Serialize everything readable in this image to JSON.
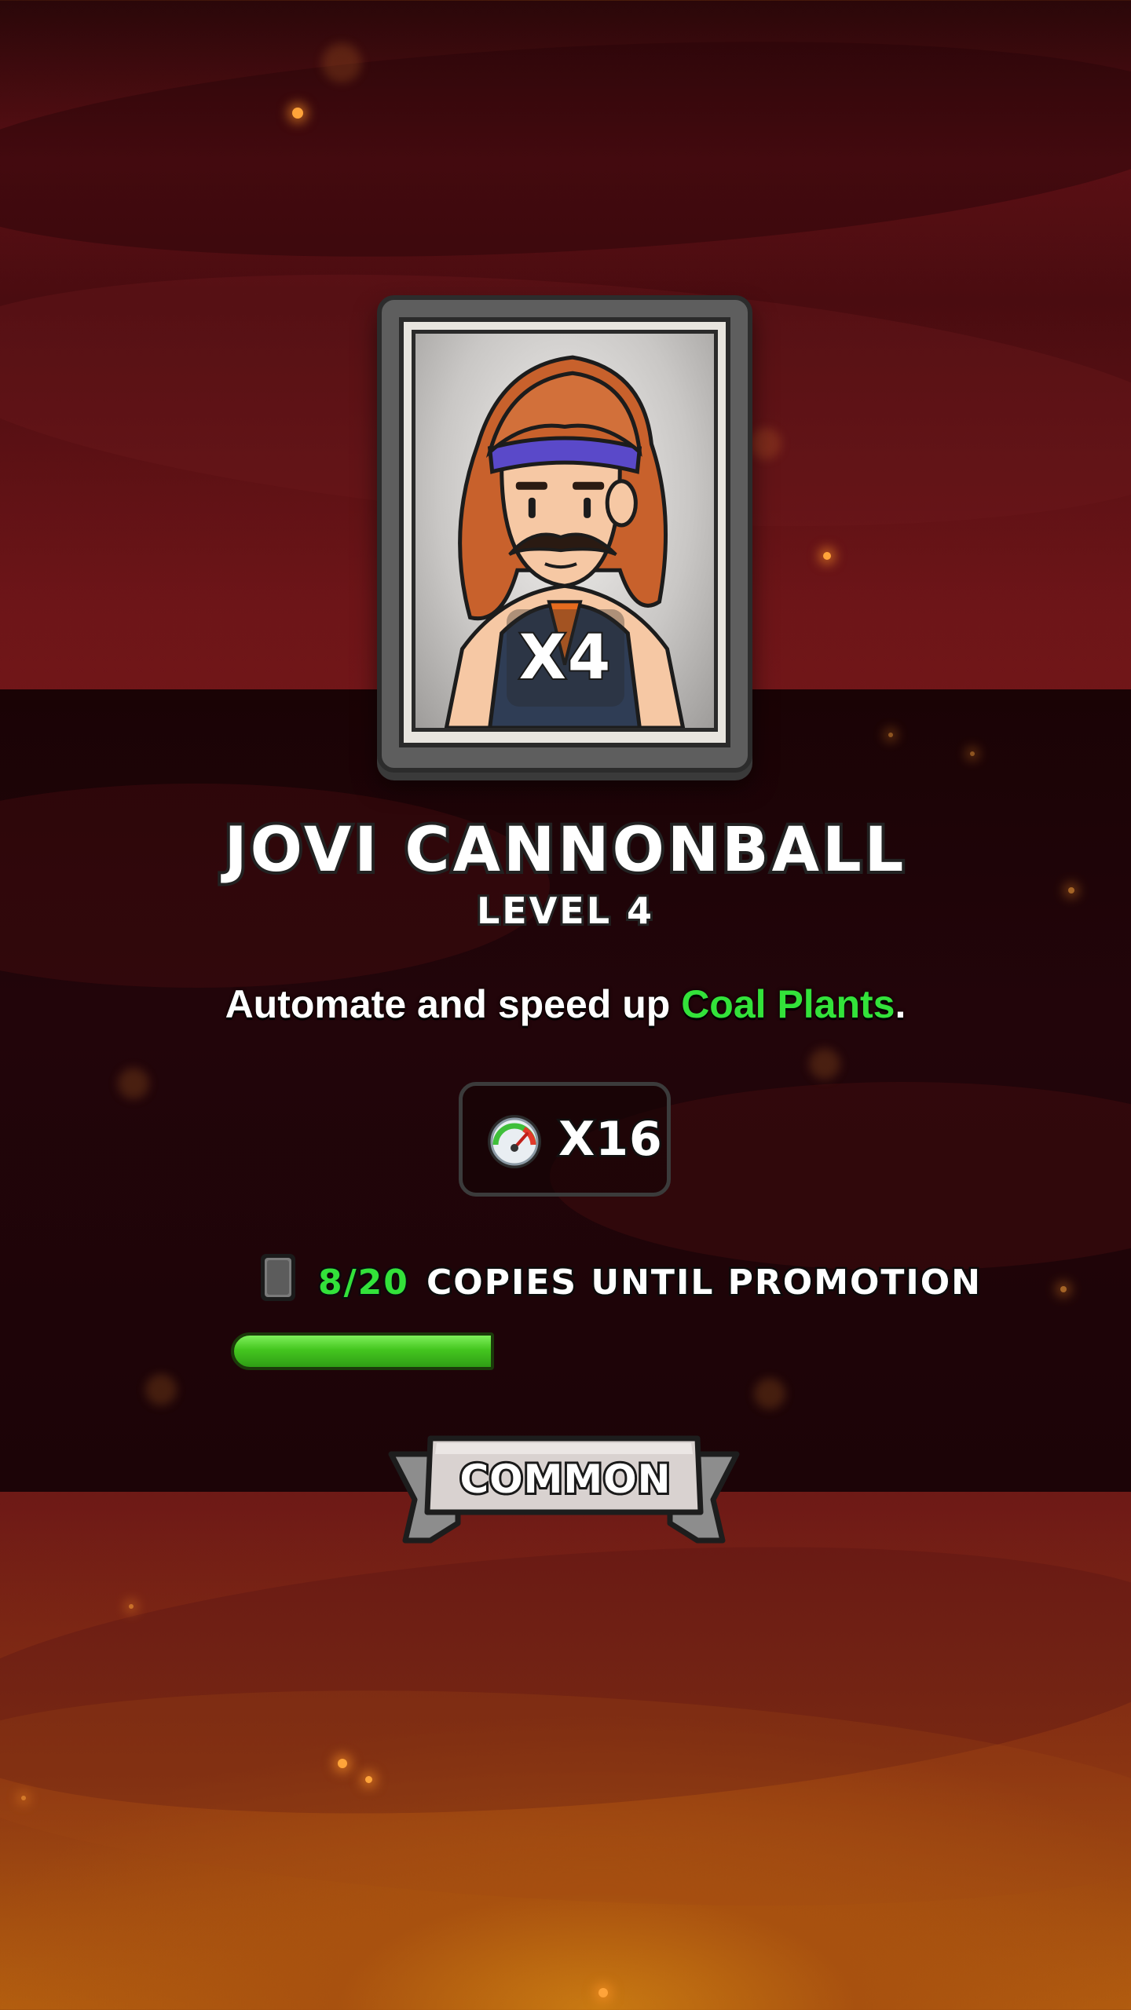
{
  "card": {
    "character_name": "JOVI CANNONBALL",
    "level_label": "LEVEL 4",
    "multiplier": "X4",
    "portrait_icon": "character-portrait"
  },
  "description": {
    "prefix": "Automate and speed up ",
    "highlight": "Coal Plants",
    "suffix": ".",
    "highlight_color": "#33e23a"
  },
  "boost": {
    "icon": "speed-gauge-icon",
    "value": "X16"
  },
  "promotion": {
    "icon": "card-icon",
    "count": "8/20",
    "label": "COPIES UNTIL PROMOTION",
    "progress_fraction": 0.4
  },
  "rarity": {
    "label": "COMMON"
  }
}
